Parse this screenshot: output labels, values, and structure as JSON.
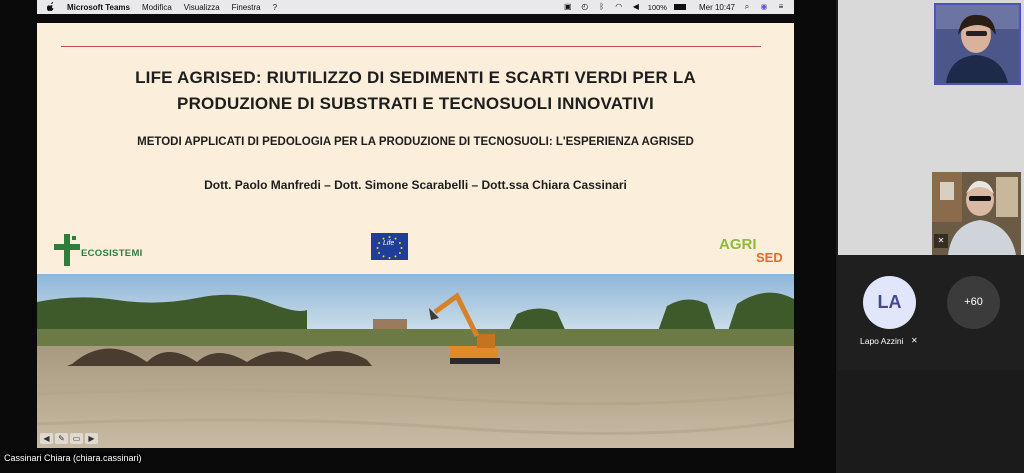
{
  "menubar": {
    "app": "Microsoft Teams",
    "menus": [
      "Modifica",
      "Visualizza",
      "Finestra",
      "?"
    ],
    "battery": "100%",
    "clock": "Mer 10:47",
    "icons": [
      "apple-icon",
      "screen-share-icon",
      "time-machine-icon",
      "bluetooth-icon",
      "wifi-icon",
      "volume-icon",
      "battery-icon",
      "search-icon",
      "siri-icon",
      "menu-extra-icon"
    ]
  },
  "slide": {
    "title_line1": "LIFE AGRISED: RIUTILIZZO DI SEDIMENTI E SCARTI VERDI PER LA",
    "title_line2": "PRODUZIONE DI SUBSTRATI E TECNOSUOLI INNOVATIVI",
    "subtitle": "METODI APPLICATI DI PEDOLOGIA PER LA PRODUZIONE DI TECNOSUOLI: L'ESPERIENZA AGRISED",
    "authors": "Dott. Paolo Manfredi – Dott. Simone Scarabelli – Dott.ssa Chiara Cassinari",
    "logo_left": "ECOSISTEMI",
    "logo_eu": "Life",
    "logo_right_a": "AGRI",
    "logo_right_b": "SED",
    "accent": "#c0504d"
  },
  "presenter": {
    "label": "Cassinari Chiara (chiara.cassinari)"
  },
  "participants": {
    "avatar_initials": "LA",
    "avatar_name": "Lapo Azzini",
    "more": "+60"
  },
  "colors": {
    "teams_purple": "#4b53bc",
    "avatar_bg": "#e1e6fb",
    "avatar_fg": "#444791"
  }
}
